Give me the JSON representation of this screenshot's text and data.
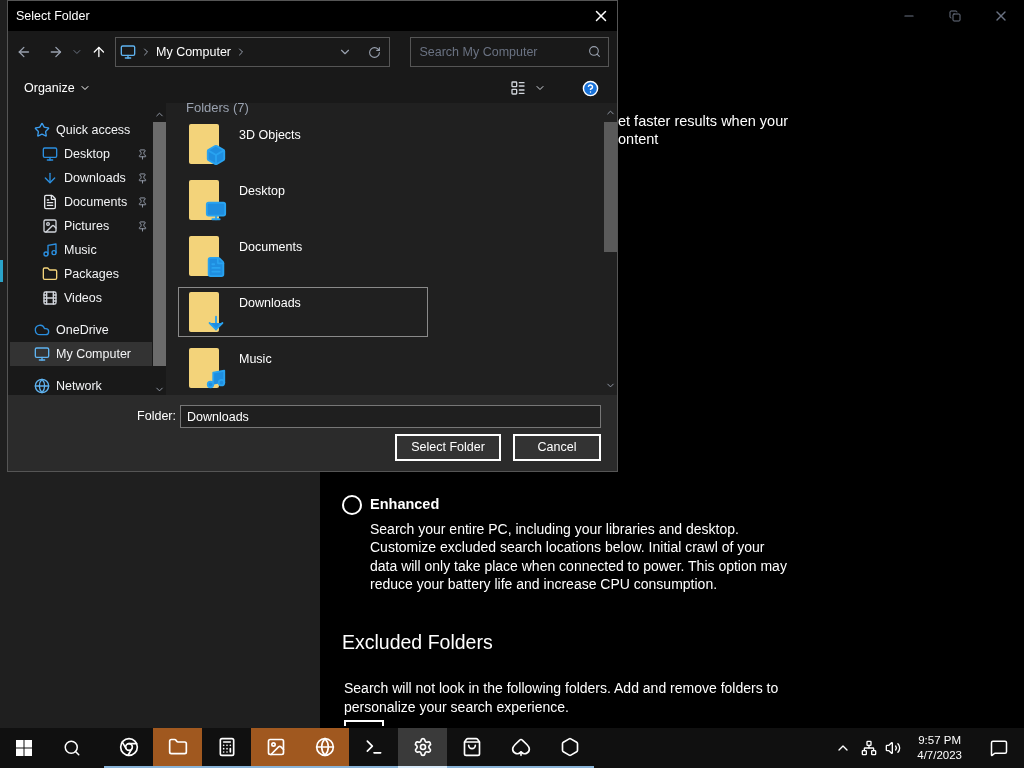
{
  "settings": {
    "partial_lines": [
      "et faster results when your",
      "ontent"
    ],
    "option": {
      "label": "Enhanced",
      "selected": false,
      "description": "Search your entire PC, including your libraries and desktop. Customize excluded search locations below. Initial crawl of your data will only take place when connected to power. This option may reduce your battery life and increase CPU consumption."
    },
    "excluded_heading": "Excluded Folders",
    "excluded_description": "Search will not look in the following folders. Add and remove folders to personalize your search experience."
  },
  "dialog": {
    "title": "Select Folder",
    "breadcrumb": "My Computer",
    "search": {
      "placeholder": "Search My Computer"
    },
    "organize": "Organize",
    "nav": [
      {
        "label": "Quick access",
        "kind": "star",
        "pinned": false,
        "selected": false,
        "children": [
          {
            "label": "Desktop",
            "kind": "desktop",
            "pinned": true,
            "selected": false
          },
          {
            "label": "Downloads",
            "kind": "download",
            "pinned": true,
            "selected": false
          },
          {
            "label": "Documents",
            "kind": "document",
            "pinned": true,
            "selected": false
          },
          {
            "label": "Pictures",
            "kind": "picture",
            "pinned": true,
            "selected": false
          },
          {
            "label": "Music",
            "kind": "music",
            "pinned": false,
            "selected": false
          },
          {
            "label": "Packages",
            "kind": "folder",
            "pinned": false,
            "selected": false
          },
          {
            "label": "Videos",
            "kind": "video",
            "pinned": false,
            "selected": false
          }
        ]
      },
      {
        "label": "OneDrive",
        "kind": "cloud",
        "pinned": false,
        "selected": false
      },
      {
        "label": "My Computer",
        "kind": "computer",
        "pinned": false,
        "selected": true
      },
      {
        "label": "Network",
        "kind": "network",
        "pinned": false,
        "selected": false
      }
    ],
    "group_header": "Folders (7)",
    "folders": [
      {
        "label": "3D Objects",
        "kind": "cube",
        "selected": false
      },
      {
        "label": "Desktop",
        "kind": "desktop",
        "selected": false
      },
      {
        "label": "Documents",
        "kind": "document",
        "selected": false
      },
      {
        "label": "Downloads",
        "kind": "download",
        "selected": true
      },
      {
        "label": "Music",
        "kind": "music",
        "selected": false
      }
    ],
    "folder_label": "Folder:",
    "folder_value": "Downloads",
    "buttons": [
      "Select Folder",
      "Cancel"
    ]
  },
  "taskbar": {
    "apps": [
      {
        "kind": "chrome",
        "flashing": false,
        "active": false
      },
      {
        "kind": "explorer",
        "flashing": true,
        "active": false
      },
      {
        "kind": "calculator",
        "flashing": false,
        "active": false
      },
      {
        "kind": "photos",
        "flashing": true,
        "active": false
      },
      {
        "kind": "edge",
        "flashing": true,
        "active": false
      },
      {
        "kind": "terminal",
        "flashing": false,
        "active": false
      },
      {
        "kind": "settings",
        "flashing": false,
        "active": true
      },
      {
        "kind": "store",
        "flashing": false,
        "active": false
      },
      {
        "kind": "cards",
        "flashing": false,
        "active": false
      },
      {
        "kind": "hexagon",
        "flashing": false,
        "active": false
      }
    ],
    "time": "9:57 PM",
    "date": "4/7/2023"
  }
}
